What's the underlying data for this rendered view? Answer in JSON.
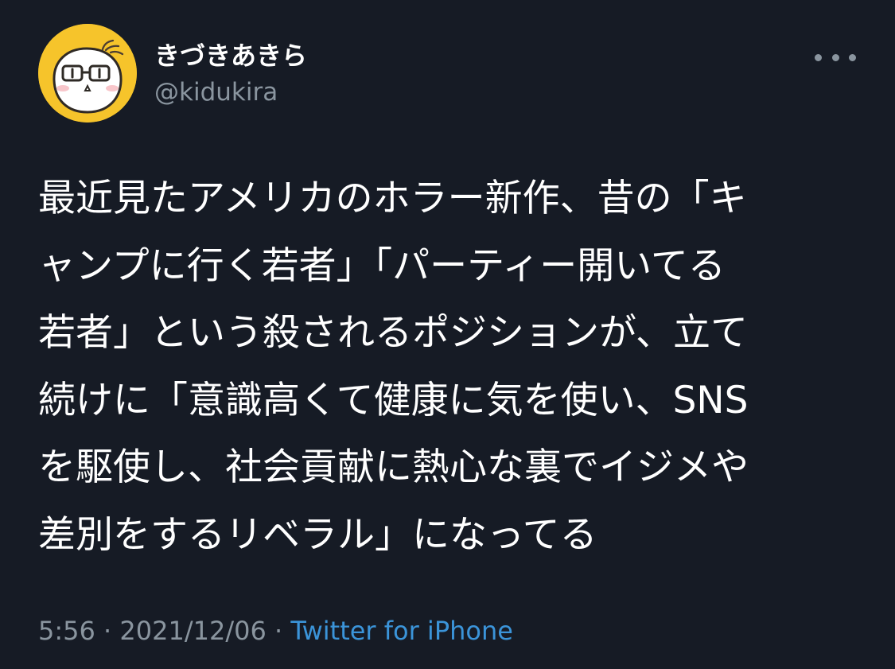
{
  "tweet": {
    "author": {
      "display_name": "きづきあきら",
      "handle": "@kidukira",
      "avatar_icon": "cartoon-face-avatar"
    },
    "more_icon": "more-horizontal-icon",
    "text_lines": [
      "最近見たアメリカのホラー新作、昔の「キ",
      "ャンプに行く若者」「パーティー開いてる",
      "若者」という殺されるポジションが、立て",
      "続けに「意識高くて健康に気を使い、SNS",
      "を駆使し、社会貢献に熱心な裏でイジメや",
      "差別をするリベラル」になってる"
    ],
    "meta": {
      "time": "5:56",
      "separator_1": " · ",
      "date": "2021/12/06",
      "separator_2": " · ",
      "source": "Twitter for iPhone"
    }
  },
  "colors": {
    "background": "#161b25",
    "text": "#ffffff",
    "secondary_text": "#8a959f",
    "link": "#3b94d9",
    "avatar_background": "#f6c42b"
  }
}
